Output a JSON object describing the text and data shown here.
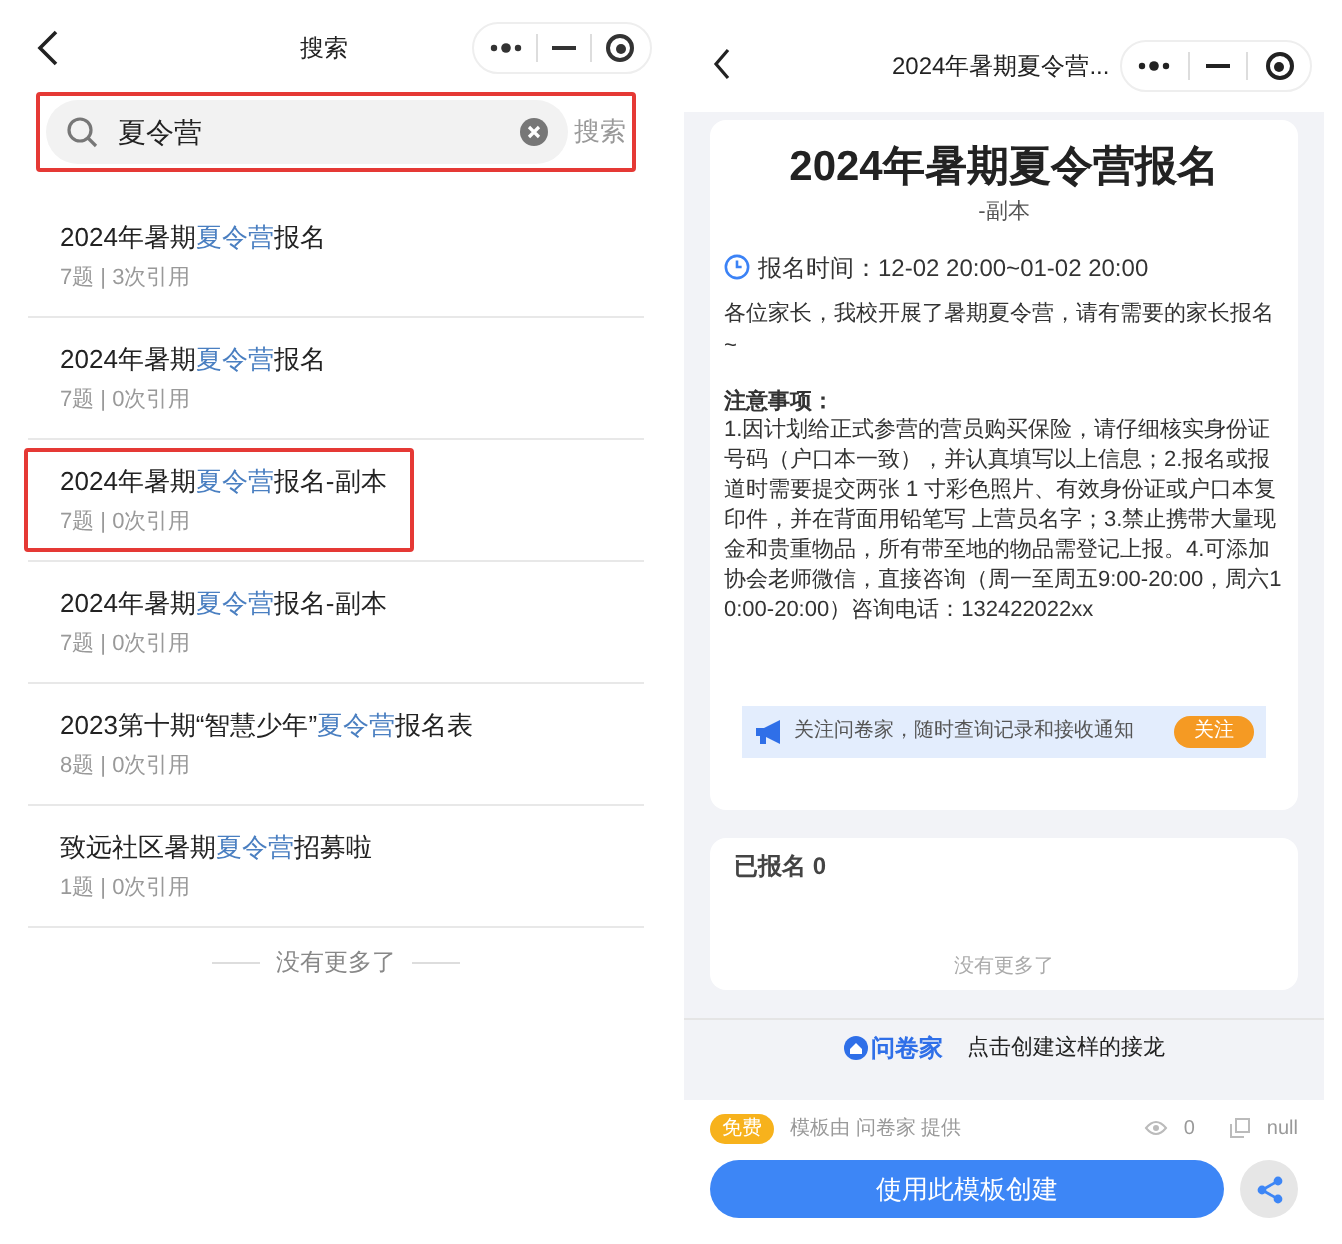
{
  "search_screen": {
    "title": "搜索",
    "search": {
      "value": "夏令营",
      "button": "搜索",
      "highlighted": true
    },
    "results": [
      {
        "title_parts": [
          {
            "text": "2024年暑期",
            "highlight": false
          },
          {
            "text": "夏令营",
            "highlight": true
          },
          {
            "text": "报名",
            "highlight": false
          }
        ],
        "meta": "7题 | 3次引用",
        "highlighted": false
      },
      {
        "title_parts": [
          {
            "text": "2024年暑期",
            "highlight": false
          },
          {
            "text": "夏令营",
            "highlight": true
          },
          {
            "text": "报名",
            "highlight": false
          }
        ],
        "meta": "7题 | 0次引用",
        "highlighted": false
      },
      {
        "title_parts": [
          {
            "text": "2024年暑期",
            "highlight": false
          },
          {
            "text": "夏令营",
            "highlight": true
          },
          {
            "text": "报名-副本",
            "highlight": false
          }
        ],
        "meta": "7题 | 0次引用",
        "highlighted": true
      },
      {
        "title_parts": [
          {
            "text": "2024年暑期",
            "highlight": false
          },
          {
            "text": "夏令营",
            "highlight": true
          },
          {
            "text": "报名-副本",
            "highlight": false
          }
        ],
        "meta": "7题 | 0次引用",
        "highlighted": false
      },
      {
        "title_parts": [
          {
            "text": "2023第十期“智慧少年”",
            "highlight": false
          },
          {
            "text": "夏令营",
            "highlight": true
          },
          {
            "text": "报名表",
            "highlight": false
          }
        ],
        "meta": "8题 | 0次引用",
        "highlighted": false
      },
      {
        "title_parts": [
          {
            "text": "致远社区暑期",
            "highlight": false
          },
          {
            "text": "夏令营",
            "highlight": true
          },
          {
            "text": "招募啦",
            "highlight": false
          }
        ],
        "meta": "1题 | 0次引用",
        "highlighted": false
      }
    ],
    "end_note": "没有更多了"
  },
  "detail_screen": {
    "title": "2024年暑期夏令营...",
    "card": {
      "heading": "2024年暑期夏令营报名",
      "subtitle": "-副本",
      "time": "报名时间：12-02 20:00~01-02 20:00",
      "intro": "各位家长，我校开展了暑期夏令营，请有需要的家长报名~",
      "notes_title": "注意事项：",
      "notes": "1.因计划给正式参营的营员购买保险，请仔细核实身份证号码（户口本一致），并认真填写以上信息；2.报名或报道时需要提交两张 1 寸彩色照片、有效身份证或户口本复印件，并在背面用铅笔写 上营员名字；3.禁止携带大量现金和贵重物品，所有带至地的物品需登记上报。4.可添加协会老师微信，直接咨询（周一至周五9:00-20:00，周六10:00-20:00）咨询电话：132422022xx",
      "follow_text": "关注问卷家，随时查询记录和接收通知",
      "follow_button": "关注"
    },
    "signups": {
      "title": "已报名 0",
      "end_note": "没有更多了"
    },
    "footer": {
      "brand": "问卷家",
      "text": "点击创建这样的接龙"
    },
    "bottom": {
      "badge": "免费",
      "provider": "模板由 问卷家 提供",
      "views": "0",
      "copies": "null",
      "button": "使用此模板创建"
    }
  }
}
